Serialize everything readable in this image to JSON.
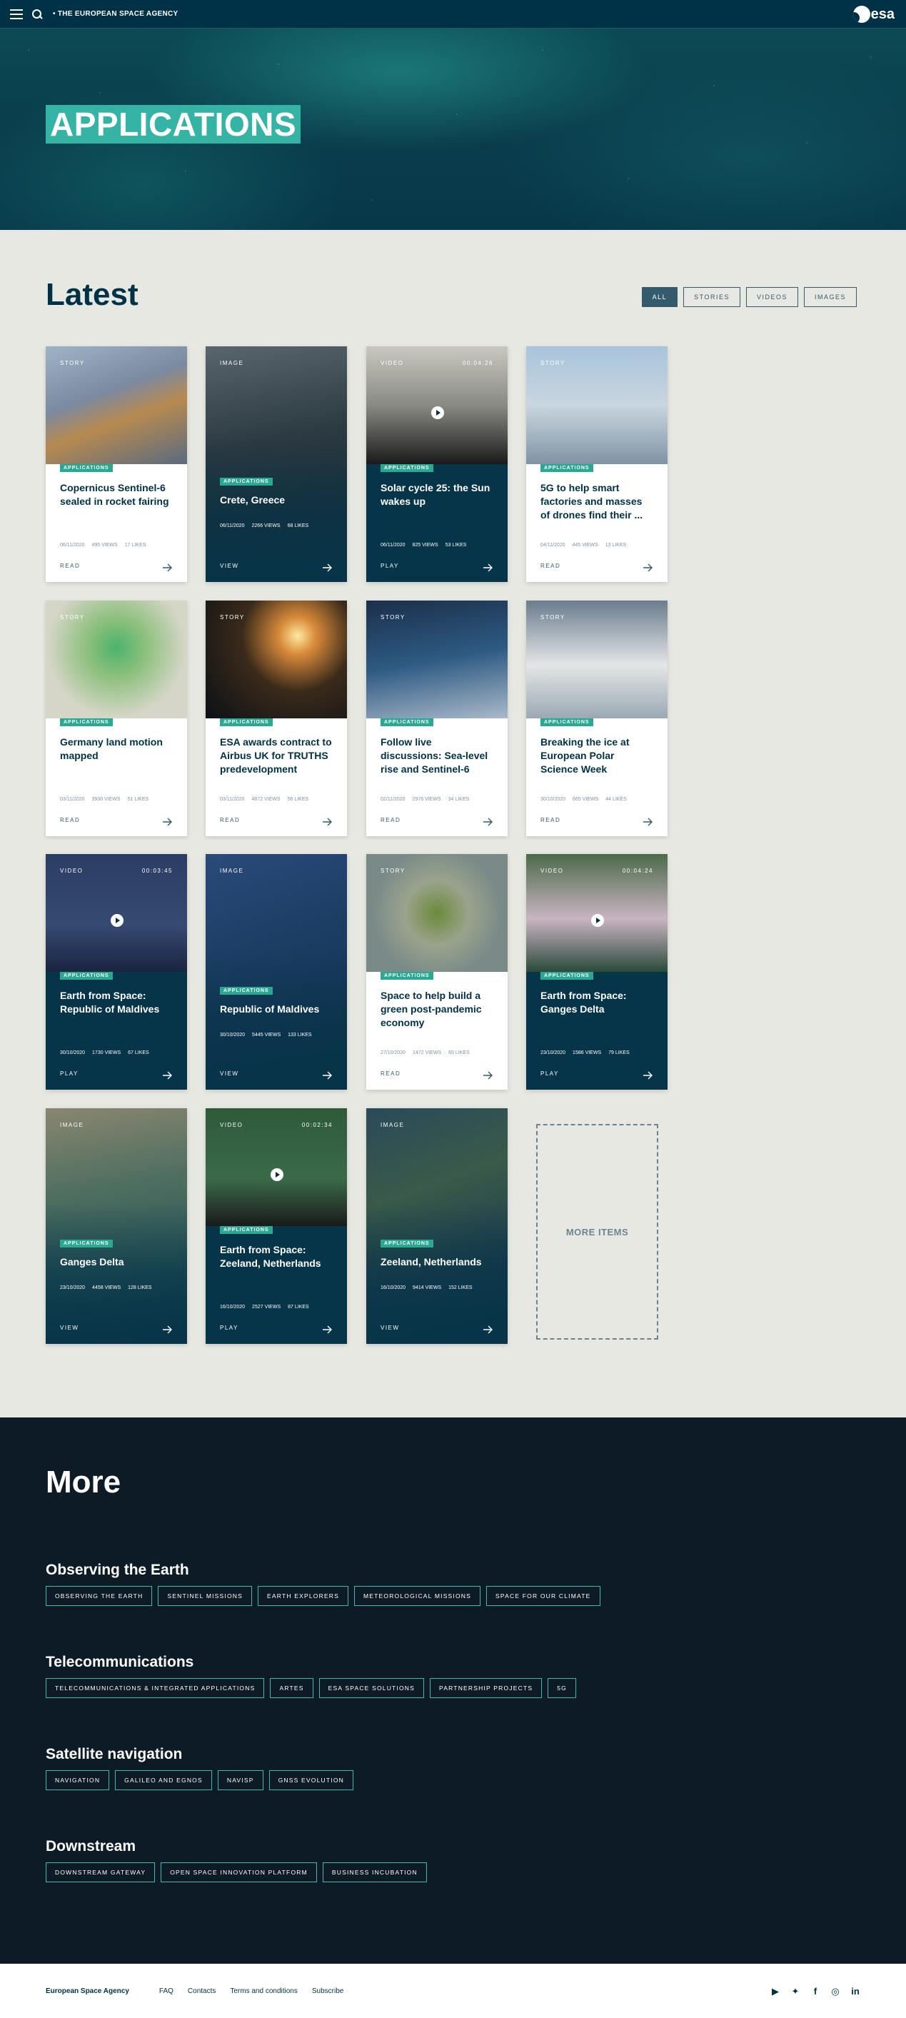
{
  "header": {
    "agency": "• THE EUROPEAN SPACE AGENCY",
    "logo_text": "esa"
  },
  "hero": {
    "title": "APPLICATIONS"
  },
  "latest": {
    "title": "Latest",
    "filters": [
      "ALL",
      "STORIES",
      "VIDEOS",
      "IMAGES"
    ],
    "more_items": "MORE ITEMS"
  },
  "cards": [
    {
      "type": "STORY",
      "duration": "",
      "tag": "APPLICATIONS",
      "title": "Copernicus Sentinel-6 sealed in rocket fairing",
      "date": "06/11/2020",
      "views": "495 VIEWS",
      "likes": "17 LIKES",
      "action": "READ"
    },
    {
      "type": "IMAGE",
      "duration": "",
      "tag": "APPLICATIONS",
      "title": "Crete, Greece",
      "date": "06/11/2020",
      "views": "2266 VIEWS",
      "likes": "68 LIKES",
      "action": "VIEW"
    },
    {
      "type": "VIDEO",
      "duration": "00:04:26",
      "tag": "APPLICATIONS",
      "title": "Solar cycle 25: the Sun wakes up",
      "date": "06/11/2020",
      "views": "825 VIEWS",
      "likes": "53 LIKES",
      "action": "PLAY"
    },
    {
      "type": "STORY",
      "duration": "",
      "tag": "APPLICATIONS",
      "title": "5G to help smart factories and masses of drones find their ...",
      "date": "04/11/2020",
      "views": "445 VIEWS",
      "likes": "13 LIKES",
      "action": "READ"
    },
    {
      "type": "STORY",
      "duration": "",
      "tag": "APPLICATIONS",
      "title": "Germany land motion mapped",
      "date": "03/11/2020",
      "views": "3930 VIEWS",
      "likes": "51 LIKES",
      "action": "READ"
    },
    {
      "type": "STORY",
      "duration": "",
      "tag": "APPLICATIONS",
      "title": "ESA awards contract to Airbus UK for TRUTHS predevelopment",
      "date": "03/11/2020",
      "views": "4872 VIEWS",
      "likes": "56 LIKES",
      "action": "READ"
    },
    {
      "type": "STORY",
      "duration": "",
      "tag": "APPLICATIONS",
      "title": "Follow live discussions: Sea-level rise and Sentinel-6",
      "date": "02/11/2020",
      "views": "2976 VIEWS",
      "likes": "34 LIKES",
      "action": "READ"
    },
    {
      "type": "STORY",
      "duration": "",
      "tag": "APPLICATIONS",
      "title": "Breaking the ice at European Polar Science Week",
      "date": "30/10/2020",
      "views": "665 VIEWS",
      "likes": "44 LIKES",
      "action": "READ"
    },
    {
      "type": "VIDEO",
      "duration": "00:03:45",
      "tag": "APPLICATIONS",
      "title": "Earth from Space: Republic of Maldives",
      "date": "30/10/2020",
      "views": "1730 VIEWS",
      "likes": "67 LIKES",
      "action": "PLAY"
    },
    {
      "type": "IMAGE",
      "duration": "",
      "tag": "APPLICATIONS",
      "title": "Republic of Maldives",
      "date": "30/10/2020",
      "views": "5445 VIEWS",
      "likes": "133 LIKES",
      "action": "VIEW"
    },
    {
      "type": "STORY",
      "duration": "",
      "tag": "APPLICATIONS",
      "title": "Space to help build a green post-pandemic economy",
      "date": "27/10/2020",
      "views": "1472 VIEWS",
      "likes": "65 LIKES",
      "action": "READ"
    },
    {
      "type": "VIDEO",
      "duration": "00:04:24",
      "tag": "APPLICATIONS",
      "title": "Earth from Space: Ganges Delta",
      "date": "23/10/2020",
      "views": "1586 VIEWS",
      "likes": "79 LIKES",
      "action": "PLAY"
    },
    {
      "type": "IMAGE",
      "duration": "",
      "tag": "APPLICATIONS",
      "title": "Ganges Delta",
      "date": "23/10/2020",
      "views": "4458 VIEWS",
      "likes": "128 LIKES",
      "action": "VIEW"
    },
    {
      "type": "VIDEO",
      "duration": "00:02:34",
      "tag": "APPLICATIONS",
      "title": "Earth from Space: Zeeland, Netherlands",
      "date": "16/10/2020",
      "views": "2527 VIEWS",
      "likes": "87 LIKES",
      "action": "PLAY"
    },
    {
      "type": "IMAGE",
      "duration": "",
      "tag": "APPLICATIONS",
      "title": "Zeeland, Netherlands",
      "date": "16/10/2020",
      "views": "9414 VIEWS",
      "likes": "152 LIKES",
      "action": "VIEW"
    }
  ],
  "more": {
    "title": "More",
    "groups": [
      {
        "title": "Observing the Earth",
        "links": [
          "OBSERVING THE EARTH",
          "SENTINEL MISSIONS",
          "EARTH EXPLORERS",
          "METEOROLOGICAL MISSIONS",
          "SPACE FOR OUR CLIMATE"
        ]
      },
      {
        "title": "Telecommunications",
        "links": [
          "TELECOMMUNICATIONS & INTEGRATED APPLICATIONS",
          "ARTES",
          "ESA SPACE SOLUTIONS",
          "PARTNERSHIP PROJECTS",
          "5G"
        ]
      },
      {
        "title": "Satellite navigation",
        "links": [
          "NAVIGATION",
          "GALILEO AND EGNOS",
          "NAVISP",
          "GNSS EVOLUTION"
        ]
      },
      {
        "title": "Downstream",
        "links": [
          "DOWNSTREAM GATEWAY",
          "OPEN SPACE INNOVATION PLATFORM",
          "BUSINESS INCUBATION"
        ]
      }
    ]
  },
  "footer": {
    "brand": "European Space Agency",
    "links": [
      "FAQ",
      "Contacts",
      "Terms and conditions",
      "Subscribe"
    ],
    "social_icons": [
      "youtube-icon",
      "twitter-icon",
      "facebook-icon",
      "instagram-icon",
      "linkedin-icon"
    ]
  },
  "colors": {
    "navy": "#003247",
    "teal_tag": "#2aa992",
    "hero_label": "#35b3a4",
    "light_bg": "#e8e8e3",
    "dark_bg": "#0d1b26"
  }
}
